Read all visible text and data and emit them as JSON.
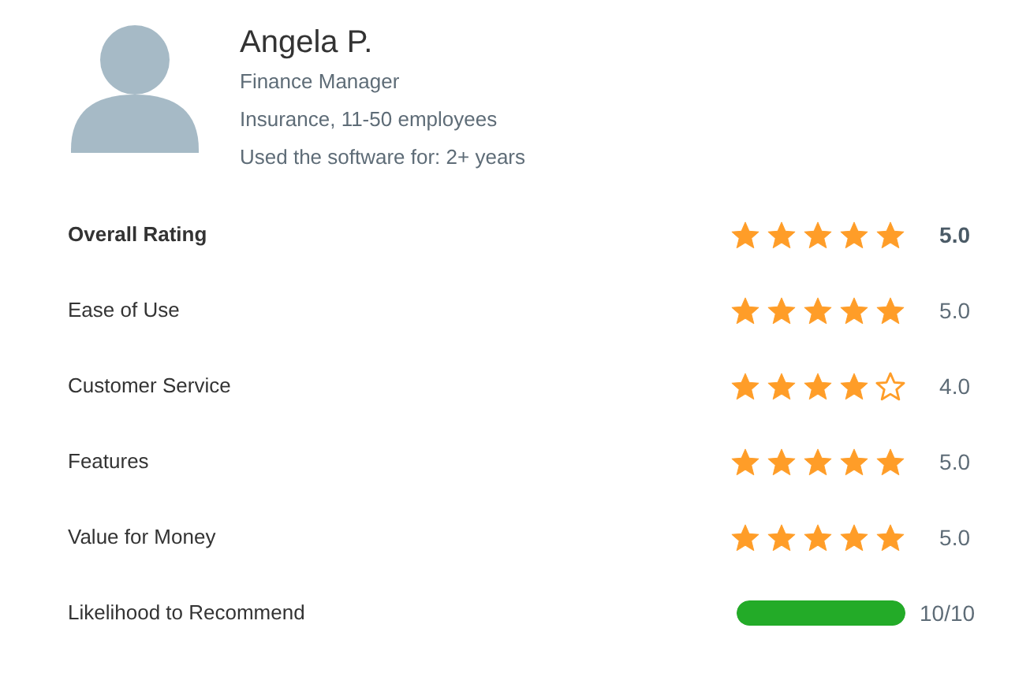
{
  "reviewer": {
    "name": "Angela P.",
    "details": [
      "Finance Manager",
      "Insurance, 11-50 employees",
      "Used the software for: 2+ years"
    ]
  },
  "ratings": [
    {
      "kind": "stars",
      "label": "Overall Rating",
      "bold": true,
      "stars": 5,
      "value": "5.0"
    },
    {
      "kind": "stars",
      "label": "Ease of Use",
      "bold": false,
      "stars": 5,
      "value": "5.0"
    },
    {
      "kind": "stars",
      "label": "Customer Service",
      "bold": false,
      "stars": 4,
      "value": "4.0"
    },
    {
      "kind": "stars",
      "label": "Features",
      "bold": false,
      "stars": 5,
      "value": "5.0"
    },
    {
      "kind": "stars",
      "label": "Value for Money",
      "bold": false,
      "stars": 5,
      "value": "5.0"
    },
    {
      "kind": "meter",
      "label": "Likelihood to Recommend",
      "bold": false,
      "level": 1,
      "value": "10/10"
    }
  ]
}
